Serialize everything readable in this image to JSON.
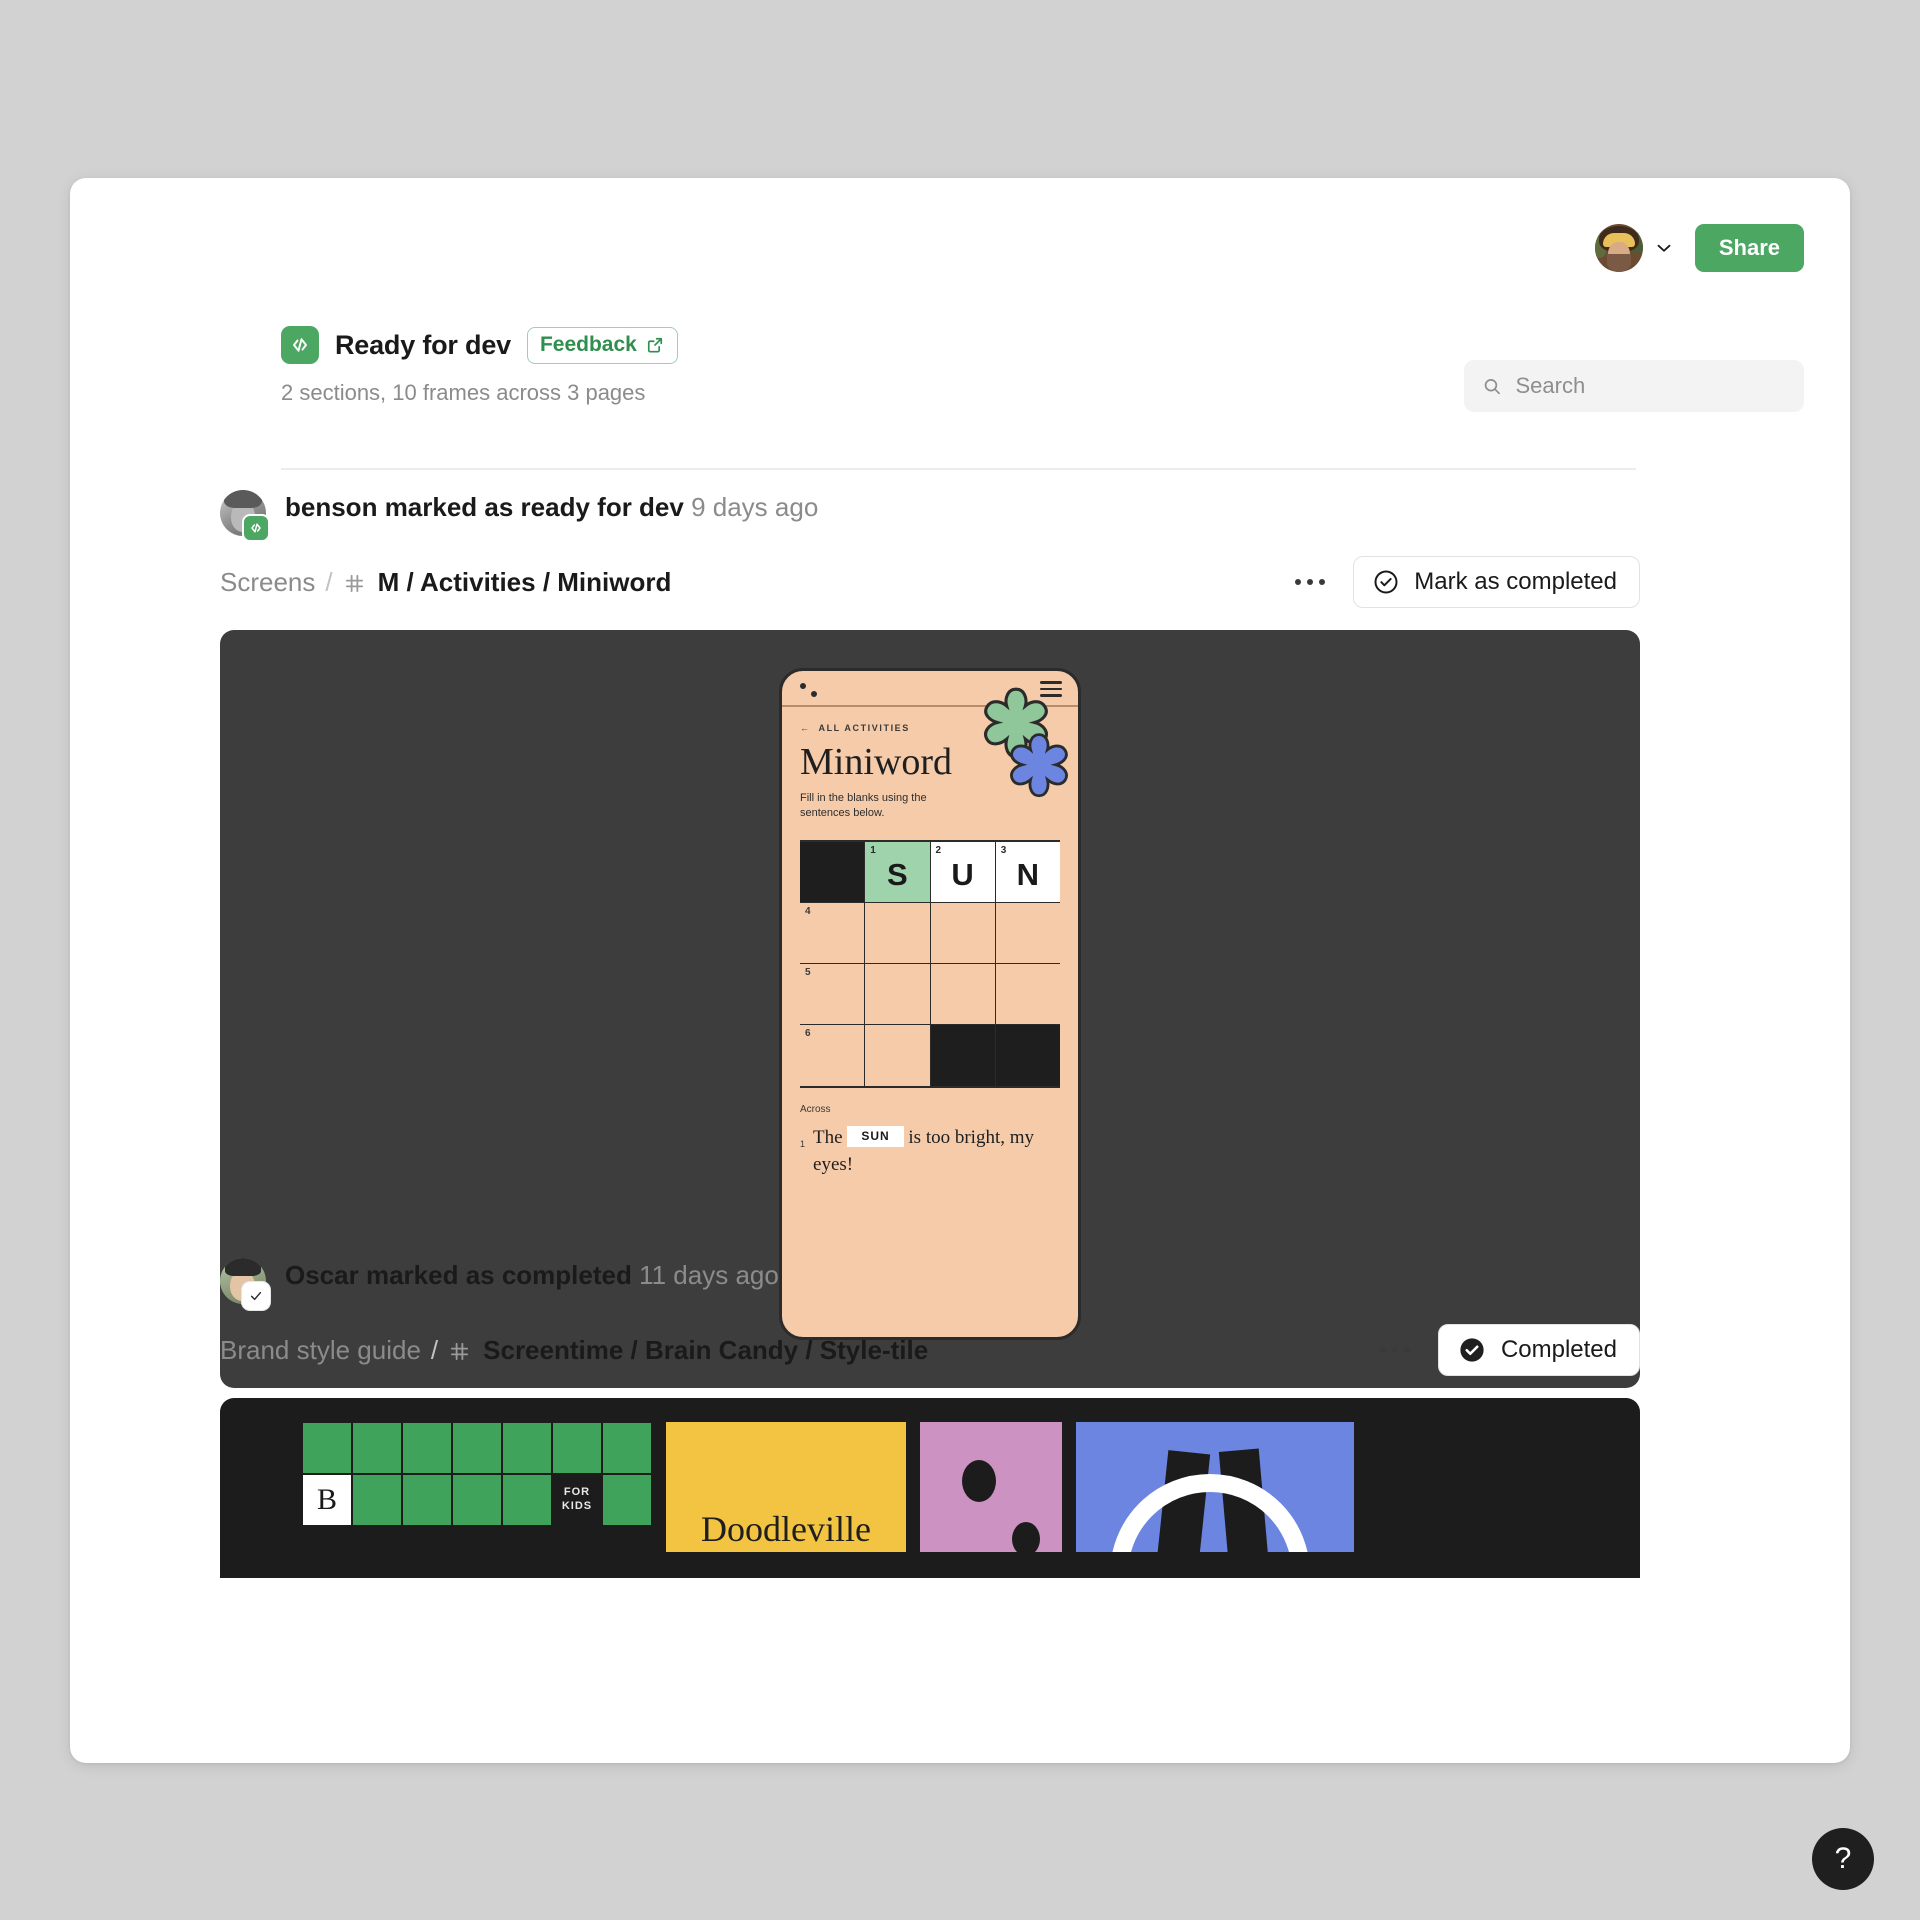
{
  "accent": {
    "green": "#4ca763",
    "green_text": "#2f8f4e"
  },
  "topbar": {
    "avatar_name": "user-avatar",
    "chevron_icon": "chevron-down-icon",
    "share_label": "Share"
  },
  "header": {
    "status_icon": "code-brackets-icon",
    "title": "Ready for dev",
    "feedback_label": "Feedback",
    "feedback_external_icon": "external-link-icon",
    "subtitle": "2 sections, 10 frames across 3 pages"
  },
  "search": {
    "placeholder": "Search",
    "value": "",
    "icon": "search-icon"
  },
  "entries": [
    {
      "actor": "benson",
      "action": "marked as ready for dev",
      "time": "9 days ago",
      "badge_icon": "code-brackets-icon",
      "breadcrumb": {
        "page": "Screens",
        "hash_icon": "frame-hash-icon",
        "frame": "M / Activities / Miniword"
      },
      "more_icon": "more-horizontal-icon",
      "action_label": "Mark as completed",
      "action_icon": "check-circle-outline-icon"
    },
    {
      "actor": "Oscar",
      "action": "marked as completed",
      "time": "11 days ago",
      "badge_icon": "check-icon",
      "breadcrumb": {
        "page": "Brand style guide",
        "hash_icon": "frame-hash-icon",
        "frame": "Screentime / Brain Candy / Style-tile"
      },
      "more_icon": "more-horizontal-icon",
      "action_label": "Completed",
      "action_icon": "check-circle-filled-icon"
    }
  ],
  "miniword": {
    "logo_icon": "two-dots-logo-icon",
    "menu_icon": "hamburger-menu-icon",
    "back_label": "ALL ACTIVITIES",
    "back_icon": "arrow-left-icon",
    "title": "Miniword",
    "description": "Fill in the blanks using the sentences below.",
    "grid": [
      [
        {
          "type": "block"
        },
        {
          "type": "green",
          "num": "1",
          "letter": "S"
        },
        {
          "type": "white",
          "num": "2",
          "letter": "U"
        },
        {
          "type": "white",
          "num": "3",
          "letter": "N"
        }
      ],
      [
        {
          "type": "open",
          "num": "4"
        },
        {
          "type": "open"
        },
        {
          "type": "open"
        },
        {
          "type": "open"
        }
      ],
      [
        {
          "type": "open",
          "num": "5"
        },
        {
          "type": "open"
        },
        {
          "type": "open"
        },
        {
          "type": "open"
        }
      ],
      [
        {
          "type": "open",
          "num": "6"
        },
        {
          "type": "open"
        },
        {
          "type": "block"
        },
        {
          "type": "block"
        }
      ]
    ],
    "clues_heading": "Across",
    "clue": {
      "num": "1",
      "before": "The",
      "answer": "SUN",
      "after": "is too bright, my eyes!"
    }
  },
  "style_tile": {
    "letter_cell": "B",
    "for_kids": "FOR\nKIDS",
    "for_kids_line1": "FOR",
    "for_kids_line2": "KIDS",
    "doodleville": "Doodleville",
    "colors": {
      "green": "#40a35b",
      "yellow": "#f3c342",
      "pink": "#cc93c2",
      "blue": "#6b85e0",
      "dark": "#1c1c1c"
    }
  },
  "help": {
    "label": "?",
    "icon": "question-mark-icon"
  }
}
